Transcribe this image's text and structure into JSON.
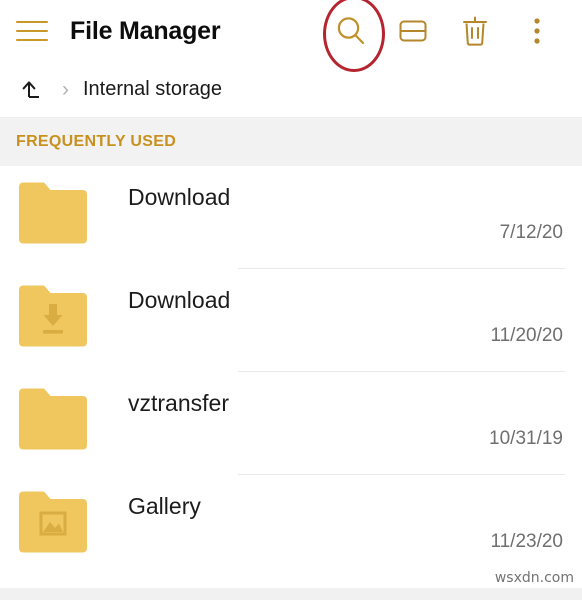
{
  "appbar": {
    "menu_icon": "hamburger-menu-icon",
    "title": "File Manager",
    "actions": [
      {
        "icon": "search-icon",
        "label": "Search",
        "highlighted": true
      },
      {
        "icon": "split-view-icon",
        "label": "Split view"
      },
      {
        "icon": "trash-icon",
        "label": "Trash"
      },
      {
        "icon": "more-vertical-icon",
        "label": "More options"
      }
    ],
    "highlight_color": "#b5242f",
    "accent_color": "#c9982a"
  },
  "breadcrumb": {
    "up_icon": "up-level-arrow-icon",
    "separator": "›",
    "path": "Internal storage"
  },
  "section": {
    "title": "FREQUENTLY USED",
    "background": "#f2f2f2",
    "text_color": "#c8911f"
  },
  "files": [
    {
      "name": "Download",
      "date": "7/12/20",
      "icon": "folder-plain-icon"
    },
    {
      "name": "Download",
      "date": "11/20/20",
      "icon": "folder-download-icon"
    },
    {
      "name": "vztransfer",
      "date": "10/31/19",
      "icon": "folder-plain-icon"
    },
    {
      "name": "Gallery",
      "date": "11/23/20",
      "icon": "folder-image-icon"
    }
  ],
  "watermark": "wsxdn.com",
  "folder_color": "#efc75e"
}
